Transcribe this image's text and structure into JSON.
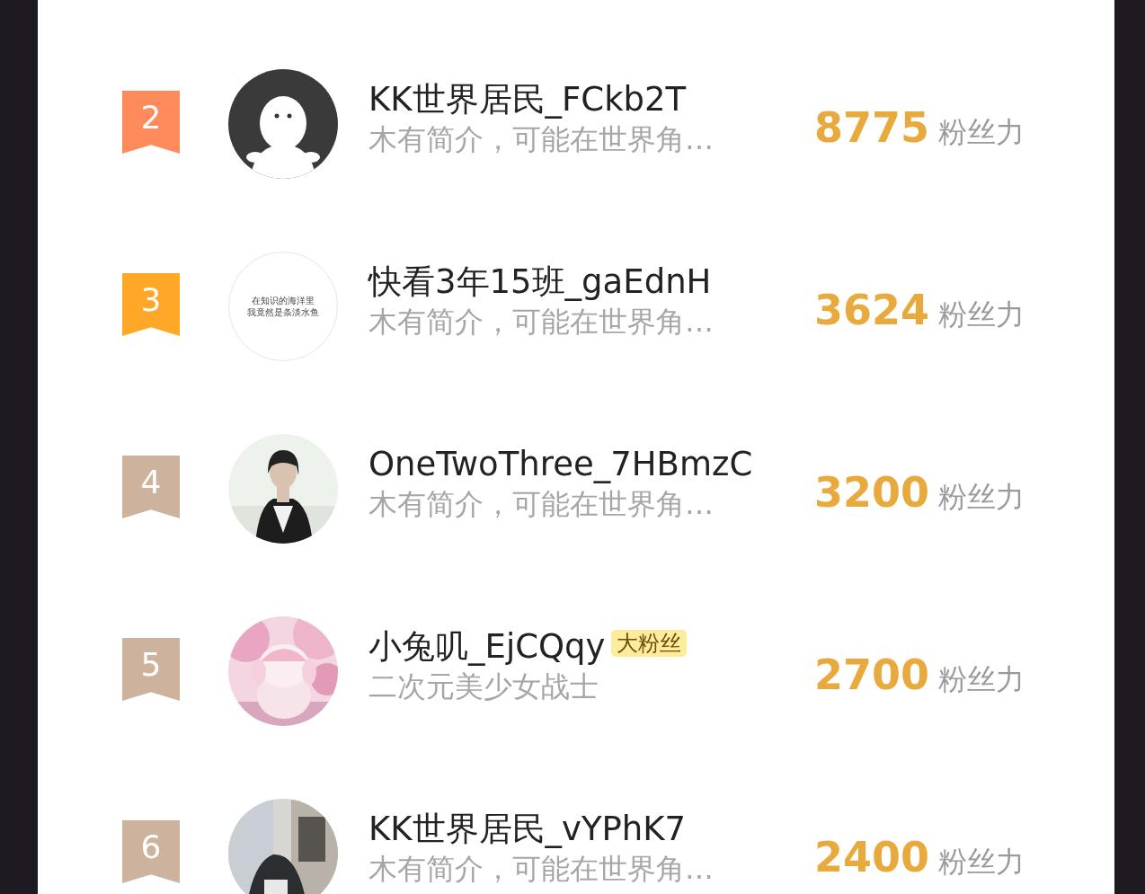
{
  "ranking": [
    {
      "rank": "2",
      "color": "#ff8a5c",
      "avatar": {
        "kind": "ghost"
      },
      "name": "KK世界居民_FCkb2T",
      "intro": "木有简介，可能在世界角…",
      "score": "8775",
      "score_unit": "粉丝力"
    },
    {
      "rank": "3",
      "color": "#ffa726",
      "avatar": {
        "kind": "text",
        "lines": [
          "在知识的海洋里",
          "我竟然是条淡水鱼"
        ]
      },
      "name": "快看3年15班_gaEdnH",
      "intro": "木有简介，可能在世界角…",
      "score": "3624",
      "score_unit": "粉丝力"
    },
    {
      "rank": "4",
      "color": "#cdb39d",
      "name": "OneTwoThree_7HBmzC",
      "intro": "木有简介，可能在世界角…",
      "score": "3200",
      "score_unit": "粉丝力"
    },
    {
      "rank": "5",
      "color": "#cdb39d",
      "name": "小兔叽_EjCQqy",
      "tag": "大粉丝",
      "intro": "二次元美少女战士",
      "score": "2700",
      "score_unit": "粉丝力"
    },
    {
      "rank": "6",
      "color": "#cdb39d",
      "name": "KK世界居民_vYPhK7",
      "intro": "木有简介，可能在世界角…",
      "score": "2400",
      "score_unit": "粉丝力"
    }
  ]
}
